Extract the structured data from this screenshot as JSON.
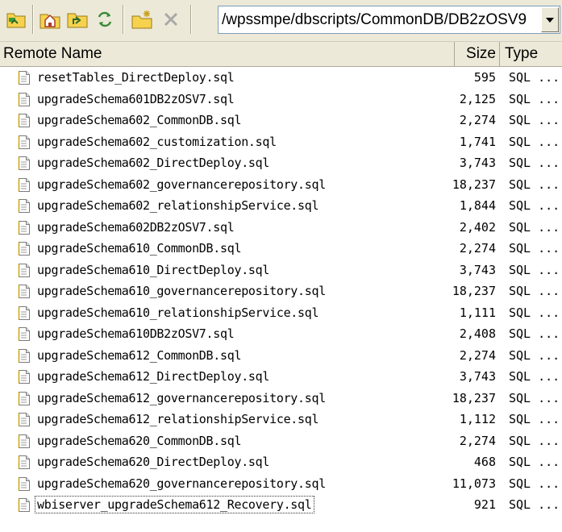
{
  "toolbar": {
    "icons": [
      "parent-folder-icon",
      "home-folder-icon",
      "up-folder-icon",
      "refresh-icon",
      "new-folder-icon",
      "delete-icon"
    ],
    "path": "/wpssmpe/dbscripts/CommonDB/DB2zOSV9"
  },
  "columns": {
    "name": "Remote Name",
    "size": "Size",
    "type": "Type"
  },
  "files": [
    {
      "name": "resetTables_DirectDeploy.sql",
      "size": "595",
      "type": "SQL ..."
    },
    {
      "name": "upgradeSchema601DB2zOSV7.sql",
      "size": "2,125",
      "type": "SQL ..."
    },
    {
      "name": "upgradeSchema602_CommonDB.sql",
      "size": "2,274",
      "type": "SQL ..."
    },
    {
      "name": "upgradeSchema602_customization.sql",
      "size": "1,741",
      "type": "SQL ..."
    },
    {
      "name": "upgradeSchema602_DirectDeploy.sql",
      "size": "3,743",
      "type": "SQL ..."
    },
    {
      "name": "upgradeSchema602_governancerepository.sql",
      "size": "18,237",
      "type": "SQL ..."
    },
    {
      "name": "upgradeSchema602_relationshipService.sql",
      "size": "1,844",
      "type": "SQL ..."
    },
    {
      "name": "upgradeSchema602DB2zOSV7.sql",
      "size": "2,402",
      "type": "SQL ..."
    },
    {
      "name": "upgradeSchema610_CommonDB.sql",
      "size": "2,274",
      "type": "SQL ..."
    },
    {
      "name": "upgradeSchema610_DirectDeploy.sql",
      "size": "3,743",
      "type": "SQL ..."
    },
    {
      "name": "upgradeSchema610_governancerepository.sql",
      "size": "18,237",
      "type": "SQL ..."
    },
    {
      "name": "upgradeSchema610_relationshipService.sql",
      "size": "1,111",
      "type": "SQL ..."
    },
    {
      "name": "upgradeSchema610DB2zOSV7.sql",
      "size": "2,408",
      "type": "SQL ..."
    },
    {
      "name": "upgradeSchema612_CommonDB.sql",
      "size": "2,274",
      "type": "SQL ..."
    },
    {
      "name": "upgradeSchema612_DirectDeploy.sql",
      "size": "3,743",
      "type": "SQL ..."
    },
    {
      "name": "upgradeSchema612_governancerepository.sql",
      "size": "18,237",
      "type": "SQL ..."
    },
    {
      "name": "upgradeSchema612_relationshipService.sql",
      "size": "1,112",
      "type": "SQL ..."
    },
    {
      "name": "upgradeSchema620_CommonDB.sql",
      "size": "2,274",
      "type": "SQL ..."
    },
    {
      "name": "upgradeSchema620_DirectDeploy.sql",
      "size": "468",
      "type": "SQL ..."
    },
    {
      "name": "upgradeSchema620_governancerepository.sql",
      "size": "11,073",
      "type": "SQL ..."
    },
    {
      "name": "wbiserver_upgradeSchema612_Recovery.sql",
      "size": "921",
      "type": "SQL ..."
    }
  ]
}
